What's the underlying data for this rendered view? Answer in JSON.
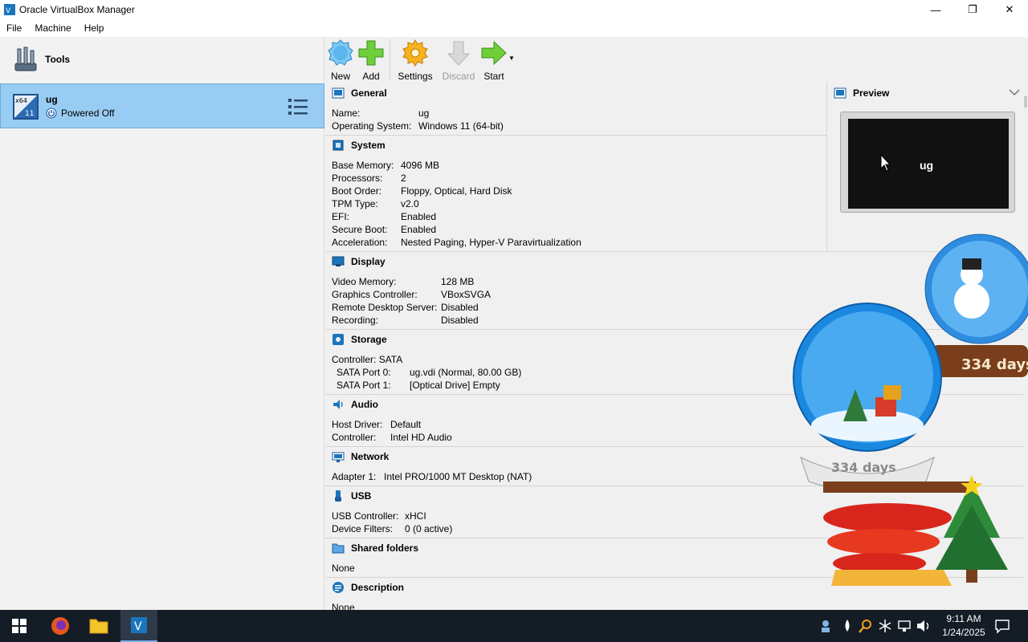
{
  "window": {
    "title": "Oracle VirtualBox Manager",
    "minimize_glyph": "—",
    "maximize_glyph": "❐",
    "close_glyph": "✕"
  },
  "menu": [
    "File",
    "Machine",
    "Help"
  ],
  "sidebar": {
    "tools_label": "Tools",
    "vm": {
      "name": "ug",
      "state": "Powered Off",
      "os_badge_top": "x64",
      "os_badge_bottom": "11"
    }
  },
  "toolbar": {
    "new": "New",
    "add": "Add",
    "settings": "Settings",
    "discard": "Discard",
    "start": "Start"
  },
  "details": {
    "general": {
      "title": "General",
      "rows": [
        {
          "label": "Name:",
          "value": "ug"
        },
        {
          "label": "Operating System:",
          "value": "Windows 11 (64-bit)"
        }
      ]
    },
    "system": {
      "title": "System",
      "rows": [
        {
          "label": "Base Memory:",
          "value": "4096 MB"
        },
        {
          "label": "Processors:",
          "value": "2"
        },
        {
          "label": "Boot Order:",
          "value": "Floppy, Optical, Hard Disk"
        },
        {
          "label": "TPM Type:",
          "value": "v2.0"
        },
        {
          "label": "EFI:",
          "value": "Enabled"
        },
        {
          "label": "Secure Boot:",
          "value": "Enabled"
        },
        {
          "label": "Acceleration:",
          "value": "Nested Paging, Hyper-V Paravirtualization"
        }
      ]
    },
    "display": {
      "title": "Display",
      "rows": [
        {
          "label": "Video Memory:",
          "value": "128 MB"
        },
        {
          "label": "Graphics Controller:",
          "value": "VBoxSVGA"
        },
        {
          "label": "Remote Desktop Server:",
          "value": "Disabled"
        },
        {
          "label": "Recording:",
          "value": "Disabled"
        }
      ]
    },
    "storage": {
      "title": "Storage",
      "controller": "Controller: SATA",
      "rows": [
        {
          "label": "SATA Port 0:",
          "value": "ug.vdi (Normal, 80.00 GB)"
        },
        {
          "label": "SATA Port 1:",
          "value": "[Optical Drive] Empty"
        }
      ]
    },
    "audio": {
      "title": "Audio",
      "rows": [
        {
          "label": "Host Driver:",
          "value": "Default"
        },
        {
          "label": "Controller:",
          "value": "Intel HD Audio"
        }
      ]
    },
    "network": {
      "title": "Network",
      "rows": [
        {
          "label": "Adapter 1:",
          "value": "Intel PRO/1000 MT Desktop (NAT)"
        }
      ]
    },
    "usb": {
      "title": "USB",
      "rows": [
        {
          "label": "USB Controller:",
          "value": "xHCI"
        },
        {
          "label": "Device Filters:",
          "value": "0 (0 active)"
        }
      ]
    },
    "shared_folders": {
      "title": "Shared folders",
      "value": "None"
    },
    "description": {
      "title": "Description",
      "value": "None"
    }
  },
  "preview": {
    "title": "Preview",
    "screen_text": "ug"
  },
  "decoration": {
    "globe_text": "334 days",
    "globe_text_right": "334 days"
  },
  "taskbar": {
    "time": "9:11 AM",
    "date": "1/24/2025"
  },
  "colors": {
    "selection": "#99ccf2",
    "taskbar": "#141c26",
    "accent": "#1c75bc"
  }
}
